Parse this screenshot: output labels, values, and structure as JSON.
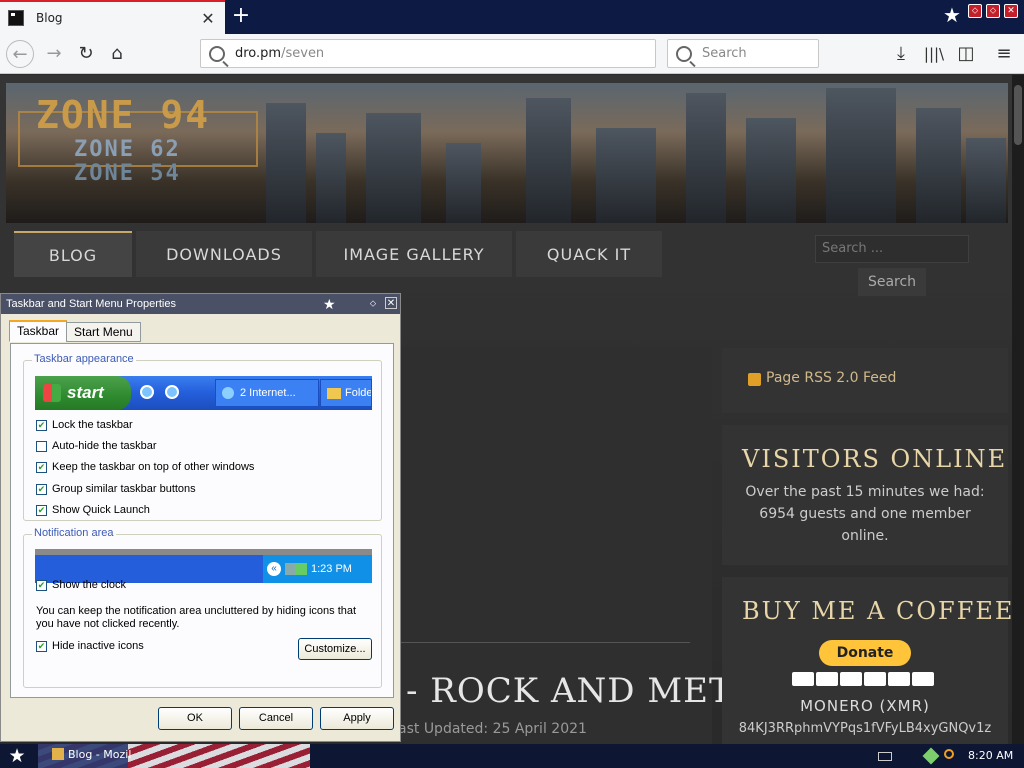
{
  "browser": {
    "tab_title": "Blog",
    "tab_close": "✕",
    "new_tab": "+",
    "url_domain": "dro.pm",
    "url_path": "/seven",
    "search_placeholder": "Search"
  },
  "site": {
    "logo_main": "ZONE 94",
    "logo_sub1": "ZONE 62",
    "logo_sub2": "ZONE 54",
    "nav": [
      "BLOG",
      "DOWNLOADS",
      "IMAGE GALLERY",
      "QUACK IT"
    ],
    "search_placeholder": "Search ...",
    "search_button": "Search",
    "post_title": "- ROCK AND METAL",
    "post_updated": "ast Updated: 25 April 2021",
    "rss_link": "Page RSS 2.0 Feed",
    "visitors_heading": "VISITORS ONLINE",
    "visitors_text": "Over the past 15 minutes we had: 6954 guests and one member online.",
    "coffee_heading": "BUY ME A COFFEE",
    "donate_label": "Donate",
    "monero_label": "MONERO (XMR)",
    "monero_address": "84KJ3RRphmVYPqs1fVFyLB4xyGNQv1z"
  },
  "dialog": {
    "title": "Taskbar and Start Menu Properties",
    "tabs": [
      "Taskbar",
      "Start Menu"
    ],
    "group_appearance": "Taskbar appearance",
    "preview_start": "start",
    "preview_task1": "2 Internet...",
    "preview_task2": "Folde",
    "options": [
      {
        "label": "Lock the taskbar",
        "checked": true
      },
      {
        "label": "Auto-hide the taskbar",
        "checked": false
      },
      {
        "label": "Keep the taskbar on top of other windows",
        "checked": true
      },
      {
        "label": "Group similar taskbar buttons",
        "checked": true
      },
      {
        "label": "Show Quick Launch",
        "checked": true
      }
    ],
    "group_notify": "Notification area",
    "preview_clock": "1:23 PM",
    "show_clock": {
      "label": "Show the clock",
      "checked": true
    },
    "notify_desc": "You can keep the notification area uncluttered by hiding icons that you have not clicked recently.",
    "hide_inactive": {
      "label": "Hide inactive icons",
      "checked": true
    },
    "customize_button": "Customize...",
    "ok_button": "OK",
    "cancel_button": "Cancel",
    "apply_button": "Apply"
  },
  "os_taskbar": {
    "task_label": "Blog - Mozil",
    "clock": "8:20 AM"
  },
  "colors": {
    "accent": "#c9a96a",
    "xp_blue": "#245edb",
    "xp_green": "#2f8a2f"
  }
}
